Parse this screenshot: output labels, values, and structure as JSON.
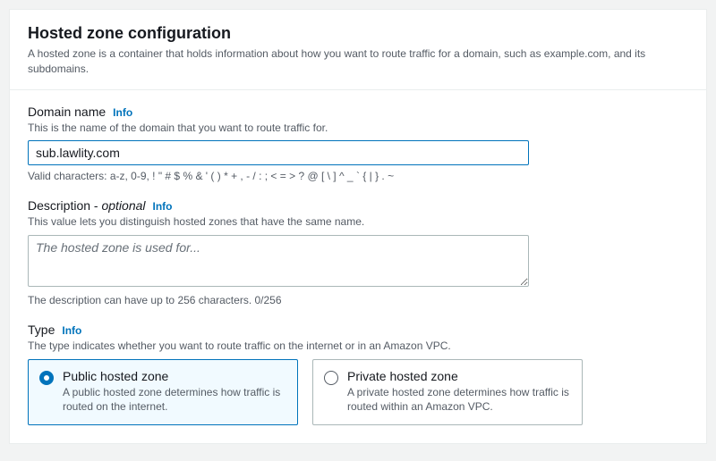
{
  "header": {
    "title": "Hosted zone configuration",
    "subtitle": "A hosted zone is a container that holds information about how you want to route traffic for a domain, such as example.com, and its subdomains."
  },
  "domain": {
    "label": "Domain name",
    "info": "Info",
    "help": "This is the name of the domain that you want to route traffic for.",
    "value": "sub.lawlity.com",
    "hint": "Valid characters: a-z, 0-9, ! \" # $ % & ' ( ) * + , - / : ; < = > ? @ [ \\ ] ^ _ ` { | } . ~"
  },
  "description": {
    "label": "Description - ",
    "optional": "optional",
    "info": "Info",
    "help": "This value lets you distinguish hosted zones that have the same name.",
    "placeholder": "The hosted zone is used for...",
    "value": "",
    "hint": "The description can have up to 256 characters. 0/256"
  },
  "type": {
    "label": "Type",
    "info": "Info",
    "help": "The type indicates whether you want to route traffic on the internet or in an Amazon VPC.",
    "options": [
      {
        "title": "Public hosted zone",
        "desc": "A public hosted zone determines how traffic is routed on the internet.",
        "selected": true
      },
      {
        "title": "Private hosted zone",
        "desc": "A private hosted zone determines how traffic is routed within an Amazon VPC.",
        "selected": false
      }
    ]
  }
}
